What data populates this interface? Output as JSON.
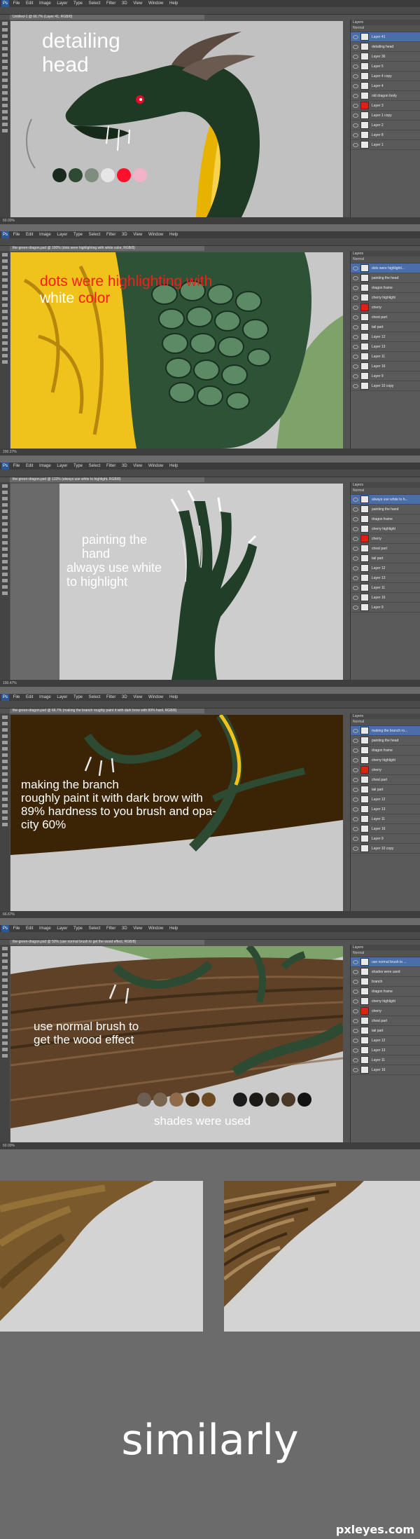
{
  "app": {
    "menu": [
      "File",
      "Edit",
      "Image",
      "Layer",
      "Type",
      "Select",
      "Filter",
      "3D",
      "View",
      "Window",
      "Help"
    ],
    "ps_badge": "Ps",
    "layers_header": "Layers",
    "blend_mode": "Normal"
  },
  "steps": [
    {
      "doc_tab": "Untitled-1 @ 66.7% (Layer 41, RGB/8)",
      "status": "50.00%",
      "overlay": [
        "detailing",
        "head"
      ],
      "layers": [
        "Layer 41",
        "detailing head",
        "Layer 36",
        "Layer 5",
        "Layer 4 copy",
        "Layer 4",
        "old dragon body",
        "Layer 3",
        "Layer 1 copy",
        "Layer 2",
        "Layer 8",
        "Layer 1"
      ]
    },
    {
      "doc_tab": "the-green-dragon.psd @ 100% (dots were highlighting with white color, RGB/8)",
      "status": "200.27%",
      "overlay_red": "dots were highlighting with",
      "overlay_white_part": "white",
      "overlay_red_part": "color",
      "layers": [
        "dots were highlighti...",
        "painting the head",
        "dragon frame",
        "cherry highlight",
        "cherry",
        "chest part",
        "tail part",
        "Layer 12",
        "Layer 13",
        "Layer 11",
        "Layer 16",
        "Layer 9",
        "Layer 10 copy"
      ]
    },
    {
      "doc_tab": "the-green-dragon.psd @ 133% (always use white to highlight, RGB/8)",
      "status": "150.47%",
      "overlay": [
        "painting the",
        "hand",
        "always use white",
        "to highlight"
      ],
      "layers": [
        "always use white to h...",
        "painting the hand",
        "dragon frame",
        "cherry highlight",
        "cherry",
        "chest part",
        "tail part",
        "Layer 12",
        "Layer 13",
        "Layer 11",
        "Layer 16",
        "Layer 9"
      ]
    },
    {
      "doc_tab": "the-green-dragon.psd @ 66.7% (making the branch roughly paint it with dark brow with 89% hard, RGB/8)",
      "status": "66.67%",
      "overlay": [
        "making the branch",
        "roughly paint it with dark brow with",
        "89% hardness to you brush and opa-",
        "city 60%"
      ],
      "layers": [
        "making the branch ro...",
        "painting the head",
        "dragon frame",
        "cherry highlight",
        "cherry",
        "chest part",
        "tail part",
        "Layer 12",
        "Layer 13",
        "Layer 11",
        "Layer 16",
        "Layer 9",
        "Layer 10 copy"
      ]
    },
    {
      "doc_tab": "the-green-dragon.psd @ 50% (use normal brush to get the wood effect, RGB/8)",
      "status": "50.00%",
      "overlay": [
        "use normal brush to",
        "get the wood effect"
      ],
      "overlay_shades": "shades were used",
      "layers": [
        "use normal brush to ...",
        "shades were used",
        "branch",
        "dragon frame",
        "cherry highlight",
        "cherry",
        "chest part",
        "tail part",
        "Layer 12",
        "Layer 13",
        "Layer 11",
        "Layer 16"
      ]
    }
  ],
  "swatches_head": [
    "#1a2a1e",
    "#2f4a33",
    "#7f8d7e",
    "#e6e6e6",
    "#ff0f2e",
    "#f2b2c8"
  ],
  "swatches_wood": [
    "#6c5e50",
    "#7a6650",
    "#8f6b4b",
    "#4a3218",
    "#6e4a24",
    "#1c1c1c",
    "#1d1a16",
    "#2b2620",
    "#4c3a28",
    "#121212"
  ],
  "footer": {
    "caption": "similarly",
    "watermark": "pxleyes.com"
  }
}
